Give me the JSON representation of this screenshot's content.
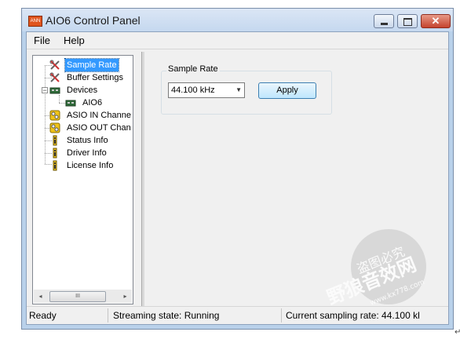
{
  "window": {
    "title": "AIO6 Control Panel",
    "icon": "app-logo-icon",
    "controls": [
      "minimize-icon",
      "maximize-icon",
      "close-icon"
    ]
  },
  "menu": [
    "File",
    "Help"
  ],
  "tree": {
    "items": [
      {
        "label": "Sample Rate",
        "icon": "tools-icon",
        "selected": true
      },
      {
        "label": "Buffer Settings",
        "icon": "tools-icon"
      },
      {
        "label": "Devices",
        "icon": "device-card-icon",
        "expanded": true
      },
      {
        "label": "AIO6",
        "icon": "device-card-icon"
      },
      {
        "label": "ASIO IN Channe",
        "icon": "channel-icon"
      },
      {
        "label": "ASIO OUT Chan",
        "icon": "channel-icon"
      },
      {
        "label": "Status Info",
        "icon": "info-icon"
      },
      {
        "label": "Driver Info",
        "icon": "info-icon"
      },
      {
        "label": "License Info",
        "icon": "info-icon"
      }
    ],
    "expander_symbol": "−",
    "scrollbar": {
      "left_arrow": "◂",
      "right_arrow": "▸",
      "thumb_grip": "III"
    }
  },
  "sample_rate": {
    "group_label": "Sample Rate",
    "selected_value": "44.100 kHz",
    "dropdown_arrow": "▼",
    "apply_label": "Apply"
  },
  "status": {
    "ready": "Ready",
    "streaming": "Streaming state: Running",
    "rate": "Current sampling rate: 44.100 kl"
  },
  "watermark": {
    "line1": "盗图必究",
    "line2": "野狼音效网",
    "url": "www.kx778.com"
  },
  "colors": {
    "selection": "#3399ff",
    "close_button": "#c5432e",
    "title_gradient_top": "#dbe6f5"
  }
}
